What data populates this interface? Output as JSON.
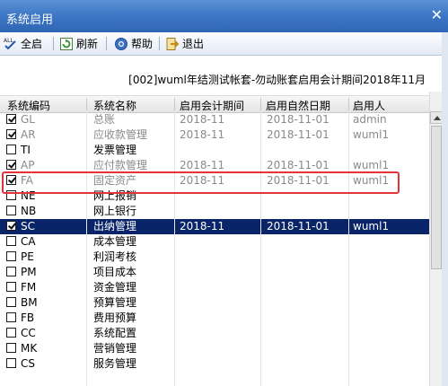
{
  "window": {
    "title": "系统启用",
    "close_glyph": "✕"
  },
  "toolbar": {
    "items": [
      {
        "label": "全启",
        "icon": "all-enable-icon"
      },
      {
        "label": "刷新",
        "icon": "refresh-icon"
      },
      {
        "label": "帮助",
        "icon": "help-icon"
      },
      {
        "label": "退出",
        "icon": "exit-icon"
      }
    ]
  },
  "info": {
    "text": "[002]wuml年结测试帐套-勿动账套启用会计期间2018年11月"
  },
  "table": {
    "columns": [
      "系统编码",
      "系统名称",
      "启用会计期间",
      "启用自然日期",
      "启用人"
    ],
    "rows": [
      {
        "checked": true,
        "code": "GL",
        "name": "总账",
        "period": "2018-11",
        "date": "2018-11-01",
        "user": "admin",
        "state": "dim"
      },
      {
        "checked": true,
        "code": "AR",
        "name": "应收款管理",
        "period": "2018-11",
        "date": "2018-11-01",
        "user": "wuml1",
        "state": "dim"
      },
      {
        "checked": false,
        "code": "TI",
        "name": "发票管理",
        "period": "",
        "date": "",
        "user": "",
        "state": "normal"
      },
      {
        "checked": true,
        "code": "AP",
        "name": "应付款管理",
        "period": "2018-11",
        "date": "2018-11-01",
        "user": "wuml1",
        "state": "dim"
      },
      {
        "checked": true,
        "code": "FA",
        "name": "固定资产",
        "period": "2018-11",
        "date": "2018-11-01",
        "user": "wuml1",
        "state": "dim"
      },
      {
        "checked": false,
        "code": "NE",
        "name": "网上报销",
        "period": "",
        "date": "",
        "user": "",
        "state": "normal"
      },
      {
        "checked": false,
        "code": "NB",
        "name": "网上银行",
        "period": "",
        "date": "",
        "user": "",
        "state": "normal"
      },
      {
        "checked": true,
        "code": "SC",
        "name": "出纳管理",
        "period": "2018-11",
        "date": "2018-11-01",
        "user": "wuml1",
        "state": "selected"
      },
      {
        "checked": false,
        "code": "CA",
        "name": "成本管理",
        "period": "",
        "date": "",
        "user": "",
        "state": "normal"
      },
      {
        "checked": false,
        "code": "PE",
        "name": "利润考核",
        "period": "",
        "date": "",
        "user": "",
        "state": "normal"
      },
      {
        "checked": false,
        "code": "PM",
        "name": "项目成本",
        "period": "",
        "date": "",
        "user": "",
        "state": "normal"
      },
      {
        "checked": false,
        "code": "FM",
        "name": "资金管理",
        "period": "",
        "date": "",
        "user": "",
        "state": "normal"
      },
      {
        "checked": false,
        "code": "BM",
        "name": "预算管理",
        "period": "",
        "date": "",
        "user": "",
        "state": "normal"
      },
      {
        "checked": false,
        "code": "FB",
        "name": "费用预算",
        "period": "",
        "date": "",
        "user": "",
        "state": "normal"
      },
      {
        "checked": false,
        "code": "CC",
        "name": "系统配置",
        "period": "",
        "date": "",
        "user": "",
        "state": "normal"
      },
      {
        "checked": false,
        "code": "MK",
        "name": "营销管理",
        "period": "",
        "date": "",
        "user": "",
        "state": "normal"
      },
      {
        "checked": false,
        "code": "CS",
        "name": "服务管理",
        "period": "",
        "date": "",
        "user": "",
        "state": "normal"
      }
    ]
  },
  "colors": {
    "titlebar": "#3f78c6",
    "selection": "#0a246a",
    "highlight_box": "#e3343b"
  }
}
